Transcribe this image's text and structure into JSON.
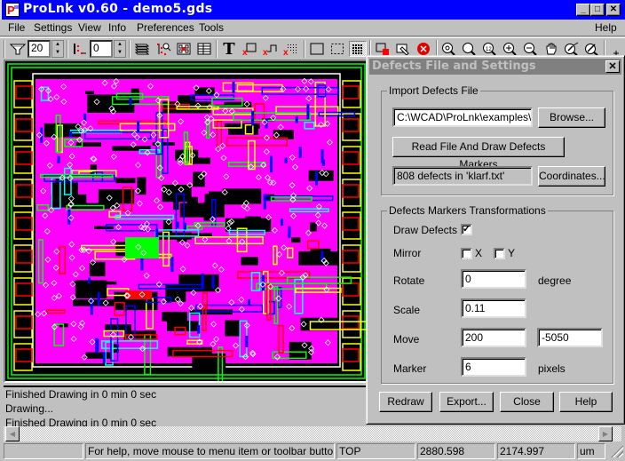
{
  "window": {
    "title": "ProLnk v0.60 - demo5.gds",
    "app_icon": "prolnk-app-icon",
    "controls": {
      "minimize": "_",
      "maximize": "□",
      "close": "✕"
    }
  },
  "menubar": {
    "items": [
      "File",
      "Settings",
      "View",
      "Info",
      "Preferences",
      "Tools"
    ],
    "help": "Help"
  },
  "toolbar": {
    "filter_value": "20",
    "level_value": "0",
    "tools": [
      {
        "name": "filter-icon"
      },
      {
        "name": "hierarchy-level-icon"
      },
      {
        "name": "layers-icon"
      },
      {
        "name": "hierarchy-search-icon"
      },
      {
        "name": "cell-center-icon"
      },
      {
        "name": "table-icon"
      },
      {
        "name": "text-icon",
        "glyph": "T"
      },
      {
        "name": "delete-box-icon"
      },
      {
        "name": "delete-path-icon"
      },
      {
        "name": "delete-grid-icon"
      },
      {
        "name": "outline-icon"
      },
      {
        "name": "dotted-outline-icon"
      },
      {
        "name": "dot-grid-icon",
        "pressed": true
      },
      {
        "name": "fill-box-icon"
      },
      {
        "name": "edit-cursor-icon"
      },
      {
        "name": "stop-icon"
      },
      {
        "name": "zoom-all-icon"
      },
      {
        "name": "zoom-window-icon"
      },
      {
        "name": "zoom-1-2-icon"
      },
      {
        "name": "zoom-in-icon"
      },
      {
        "name": "zoom-out-icon"
      },
      {
        "name": "pan-hand-icon"
      },
      {
        "name": "measure-icon"
      },
      {
        "name": "ruler-icon"
      },
      {
        "name": "crosshair-icon"
      }
    ]
  },
  "log": {
    "lines": [
      "Finished Drawing in 0 min 0 sec",
      "Drawing...",
      "Finished Drawing in 0 min 0 sec"
    ]
  },
  "statusbar": {
    "panel0": "",
    "help": "For help, move mouse to menu item or toolbar button and",
    "cell": "TOP",
    "x": "2880.598",
    "y": "2174.997",
    "units": "um"
  },
  "dialog": {
    "title": "Defects File and Settings",
    "import_group": {
      "label": "Import Defects File",
      "file_path": "C:\\WCAD\\ProLnk\\examples\\kl",
      "browse": "Browse...",
      "read_button": "Read File And Draw Defects Markers",
      "status": "808 defects in 'klarf.txt'",
      "coordinates": "Coordinates..."
    },
    "transform_group": {
      "label": "Defects Markers Transformations",
      "draw_defects_label": "Draw Defects",
      "draw_defects_checked": true,
      "mirror_label": "Mirror",
      "mirror_x_label": "X",
      "mirror_x_checked": false,
      "mirror_y_label": "Y",
      "mirror_y_checked": false,
      "rotate_label": "Rotate",
      "rotate_value": "0",
      "rotate_unit": "degree",
      "scale_label": "Scale",
      "scale_value": "0.11",
      "move_label": "Move",
      "move_x": "200",
      "move_y": "-5050",
      "marker_label": "Marker",
      "marker_value": "6",
      "marker_unit": "pixels"
    },
    "buttons": {
      "redraw": "Redraw",
      "export": "Export...",
      "close": "Close",
      "help": "Help"
    }
  },
  "layout_view": {
    "description": "GDS chip layout with defect markers",
    "layer_colors": [
      "#ff00ff",
      "#0000ff",
      "#00ffff",
      "#ffff00",
      "#ff0000",
      "#00ff00",
      "#ffffff"
    ]
  }
}
